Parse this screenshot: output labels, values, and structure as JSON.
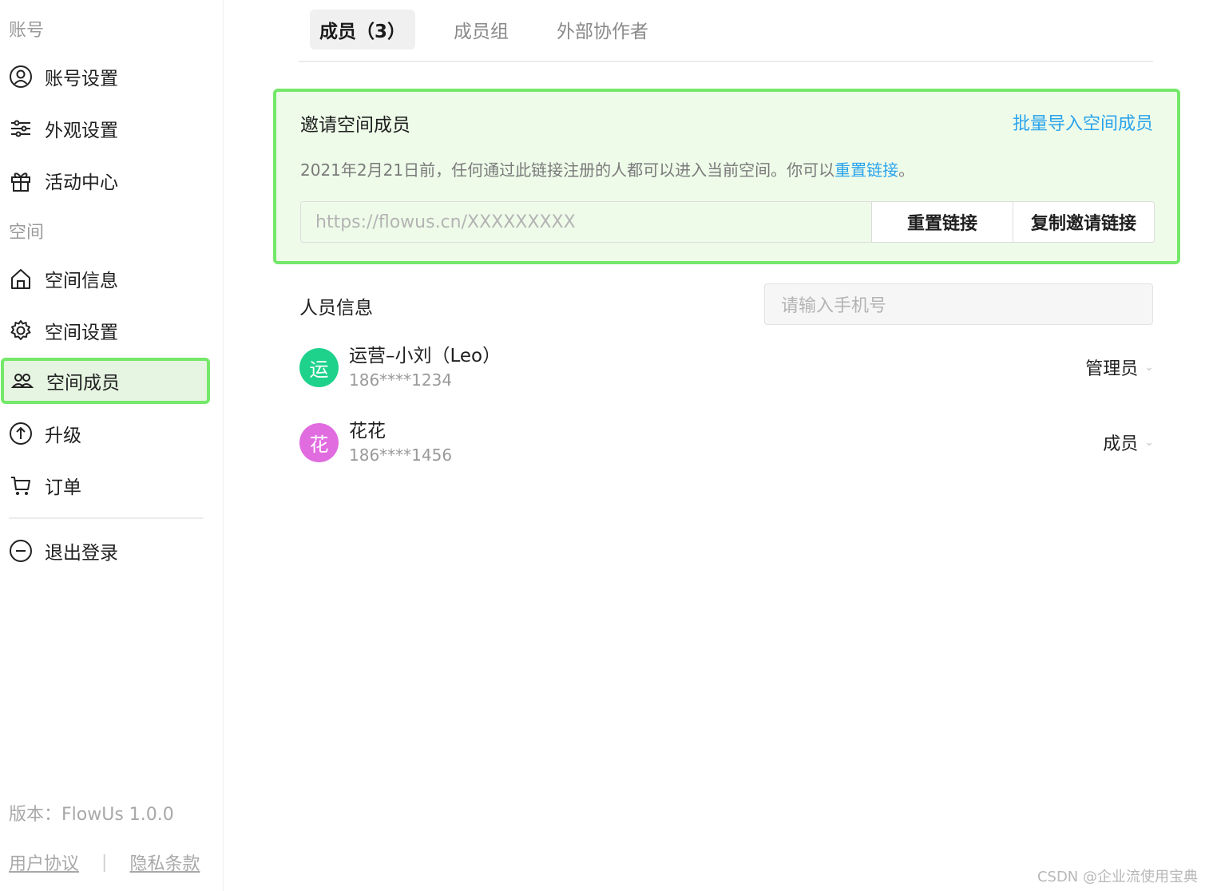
{
  "sidebar": {
    "account_section": "账号",
    "space_section": "空间",
    "items": [
      {
        "label": "账号设置"
      },
      {
        "label": "外观设置"
      },
      {
        "label": "活动中心"
      },
      {
        "label": "空间信息"
      },
      {
        "label": "空间设置"
      },
      {
        "label": "空间成员"
      },
      {
        "label": "升级"
      },
      {
        "label": "订单"
      },
      {
        "label": "退出登录"
      }
    ],
    "version": "版本：FlowUs 1.0.0",
    "user_agreement": "用户协议",
    "separator": "|",
    "privacy": "隐私条款"
  },
  "tabs": [
    {
      "label": "成员（3）"
    },
    {
      "label": "成员组"
    },
    {
      "label": "外部协作者"
    }
  ],
  "invite": {
    "title": "邀请空间成员",
    "bulk_import": "批量导入空间成员",
    "desc_prefix": "2021年2月21日前，任何通过此链接注册的人都可以进入当前空间。你可以",
    "desc_link": "重置链接",
    "desc_suffix": "。",
    "url": "https://flowus.cn/XXXXXXXXX",
    "reset_button": "重置链接",
    "copy_button": "复制邀请链接"
  },
  "members": {
    "title": "人员信息",
    "search_placeholder": "请输入手机号",
    "list": [
      {
        "avatar": "运",
        "avatar_color": "#1ed28c",
        "name": "运营–小刘（Leo）",
        "phone": "186****1234",
        "role": "管理员"
      },
      {
        "avatar": "花",
        "avatar_color": "#e06ce0",
        "name": "花花",
        "phone": "186****1456",
        "role": "成员"
      }
    ]
  },
  "colors": {
    "highlight_border": "#75e86a",
    "link": "#2aa3ec"
  },
  "watermark": "CSDN @企业流使用宝典"
}
